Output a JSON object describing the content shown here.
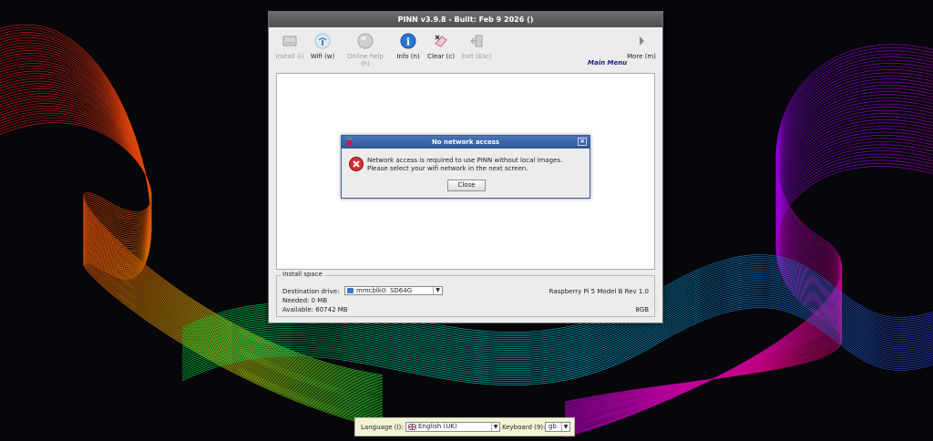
{
  "window": {
    "title": "PINN v3.9.8 - Built: Feb  9 2026 ()"
  },
  "toolbar": {
    "items": [
      {
        "label": "Install (i)",
        "icon": "install-disk-icon",
        "enabled": false
      },
      {
        "label": "Wifi (w)",
        "icon": "wifi-icon",
        "enabled": true
      },
      {
        "label": "Online help (h)",
        "icon": "globe-icon",
        "enabled": false
      },
      {
        "label": "Info (n)",
        "icon": "info-icon",
        "enabled": true
      },
      {
        "label": "Clear (c)",
        "icon": "eraser-icon",
        "enabled": true
      },
      {
        "label": "Exit (Esc)",
        "icon": "exit-icon",
        "enabled": false
      },
      {
        "label": "More (m)",
        "icon": "arrow-right-icon",
        "enabled": true
      }
    ],
    "menu_label": "Main Menu"
  },
  "install_space": {
    "title": "Install space",
    "destination_label": "Destination drive:",
    "destination_value": "mmcblk0: SD64G",
    "needed": "Needed: 0 MB",
    "available": "Available: 60742 MB",
    "device": "Raspberry Pi 5 Model B Rev 1.0",
    "memory": "8GB"
  },
  "dialog": {
    "title": "No network access",
    "message": "Network access is required to use PINN without local images. Please select your wifi network in the next screen.",
    "button": "Close",
    "close_glyph": "×"
  },
  "langbar": {
    "language_label": "Language (l):",
    "language_value": "English (UK)",
    "keyboard_label": "Keyboard (9):",
    "keyboard_value": "gb"
  },
  "colors": {
    "dialog_title": "#2f559a",
    "menu_label": "#1a237e",
    "error_red": "#d32f2f"
  }
}
